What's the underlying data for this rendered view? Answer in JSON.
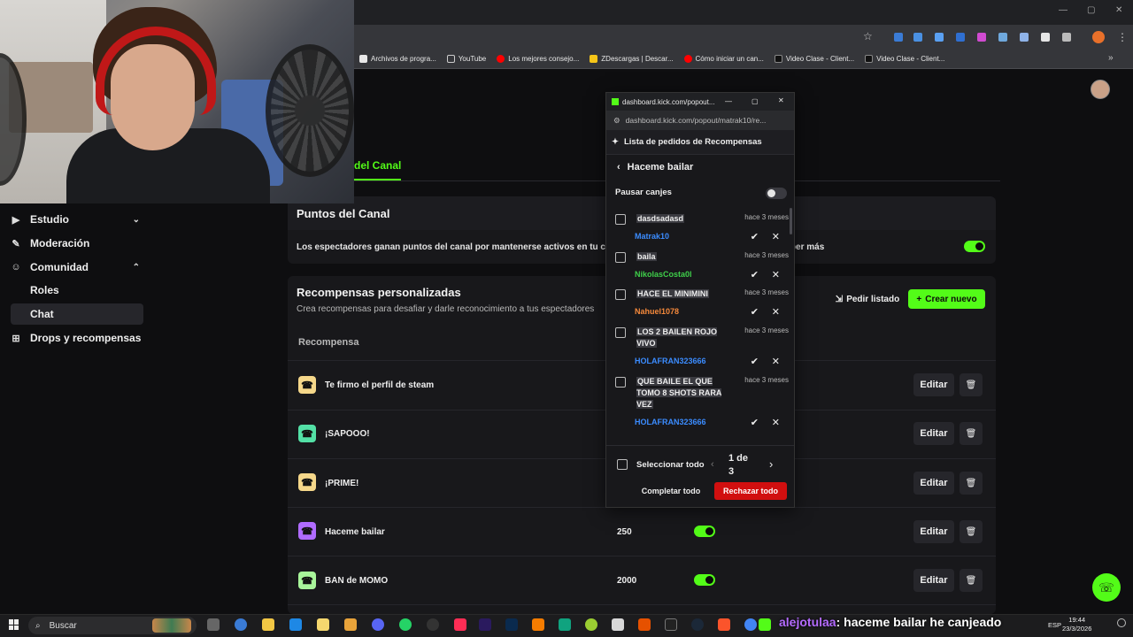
{
  "colors": {
    "accent": "#53fc18",
    "danger": "#d10f0f",
    "bg": "#0e0e10",
    "panel": "#18181b"
  },
  "bookmarks": [
    "Archivos de progra...",
    "YouTube",
    "Los mejores consejo...",
    "ZDescargas | Descar...",
    "Cómo iniciar un can...",
    "Video Clase - Client...",
    "Video Clase - Client..."
  ],
  "tabs": {
    "active": "del Canal"
  },
  "sidebar": {
    "items": [
      {
        "label": "Estudio",
        "icon": "video-icon",
        "chevron": "chevron-down-icon"
      },
      {
        "label": "Moderación",
        "icon": "wrench-icon"
      },
      {
        "label": "Comunidad",
        "icon": "people-icon",
        "chevron": "chevron-up-icon"
      }
    ],
    "sub": [
      "Roles",
      "Chat"
    ],
    "last": {
      "label": "Drops y recompensas",
      "icon": "gift-icon"
    }
  },
  "points": {
    "title": "Puntos del Canal",
    "desc": "Los espectadores ganan puntos del canal por mantenerse activos en tu canal.",
    "desc_tail": "as. Saber más",
    "enabled": true
  },
  "custom": {
    "title": "Recompensas personalizadas",
    "subtitle": "Crea recompensas para desafiar y darle reconocimiento a tus espectadores",
    "list_button": "Pedir listado",
    "new_button": "Crear nuevo",
    "col_header": "Recompensa",
    "edit_label": "Editar",
    "rows": [
      {
        "name": "Te firmo el perfil de steam",
        "cost": "",
        "color": "#f5d78a"
      },
      {
        "name": "¡SAPOOO!",
        "cost": "",
        "color": "#53e0a6"
      },
      {
        "name": "¡PRIME!",
        "cost": "",
        "color": "#f5d78a"
      },
      {
        "name": "Haceme bailar",
        "cost": "250",
        "color": "#b06bff",
        "enabled": true
      },
      {
        "name": "BAN de MOMO",
        "cost": "2000",
        "color": "#a8f59a",
        "enabled": true
      }
    ]
  },
  "popout": {
    "window_title": "dashboard.kick.com/popout...",
    "url": "dashboard.kick.com/popout/matrak10/re...",
    "header": "Lista de pedidos de Recompensas",
    "reward_title": "Haceme bailar",
    "pause_label": "Pausar canjes",
    "paused": false,
    "requests": [
      {
        "text": "dasdsadasd",
        "time": "hace 3 meses",
        "user": "Matrak10",
        "user_color": "#3b8cff"
      },
      {
        "text": "baila",
        "time": "hace 3 meses",
        "user": "NikolasCosta0l",
        "user_color": "#3fcf4a"
      },
      {
        "text": "HACE EL MINIMINI",
        "time": "hace 3 meses",
        "user": "Nahuel1078",
        "user_color": "#f5893b"
      },
      {
        "text": "LOS 2 BAILEN ROJO VIVO",
        "time": "hace 3 meses",
        "user": "HOLAFRAN323666",
        "user_color": "#3b8cff"
      },
      {
        "text": "QUE BAILE EL QUE TOMO 8 SHOTS RARA VEZ",
        "time": "hace 3 meses",
        "user": "HOLAFRAN323666",
        "user_color": "#3b8cff"
      }
    ],
    "select_all": "Seleccionar todo",
    "page": "1 de 3",
    "complete_all": "Completar todo",
    "reject_all": "Rechazar todo"
  },
  "taskbar": {
    "search": "Buscar",
    "ticker_user": "alejotulaa",
    "ticker_text": ": haceme bailar he canjeado",
    "lang": "ESP",
    "time": "19:44",
    "date": "23/3/2026"
  }
}
